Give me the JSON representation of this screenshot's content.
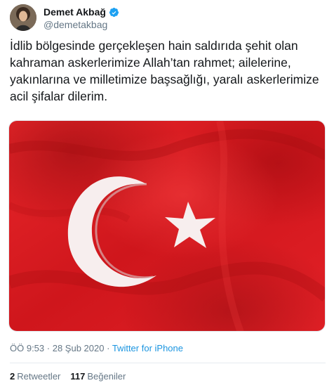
{
  "author": {
    "display_name": "Demet Akbağ",
    "handle": "@demetakbag",
    "verified": true,
    "verified_icon": "verified-badge-icon"
  },
  "tweet": {
    "text": "İdlib bölgesinde gerçekleşen hain saldırıda şehit olan kahraman askerlerimize Allah’tan rahmet; ailelerine, yakınlarına ve milletimize başsağlığı, yaralı askerlerimize acil şifalar dilerim.",
    "media_alt": "turkish-flag-image"
  },
  "meta": {
    "time": "ÖÖ 9:53",
    "separator": "·",
    "date": "28 Şub 2020",
    "source": "Twitter for iPhone"
  },
  "stats": {
    "retweets_count": "2",
    "retweets_label": "Retweetler",
    "likes_count": "117",
    "likes_label": "Beğeniler"
  },
  "colors": {
    "flag_red": "#d6191f",
    "link_blue": "#1b95e0",
    "muted_gray": "#657786",
    "text_dark": "#14171a"
  }
}
